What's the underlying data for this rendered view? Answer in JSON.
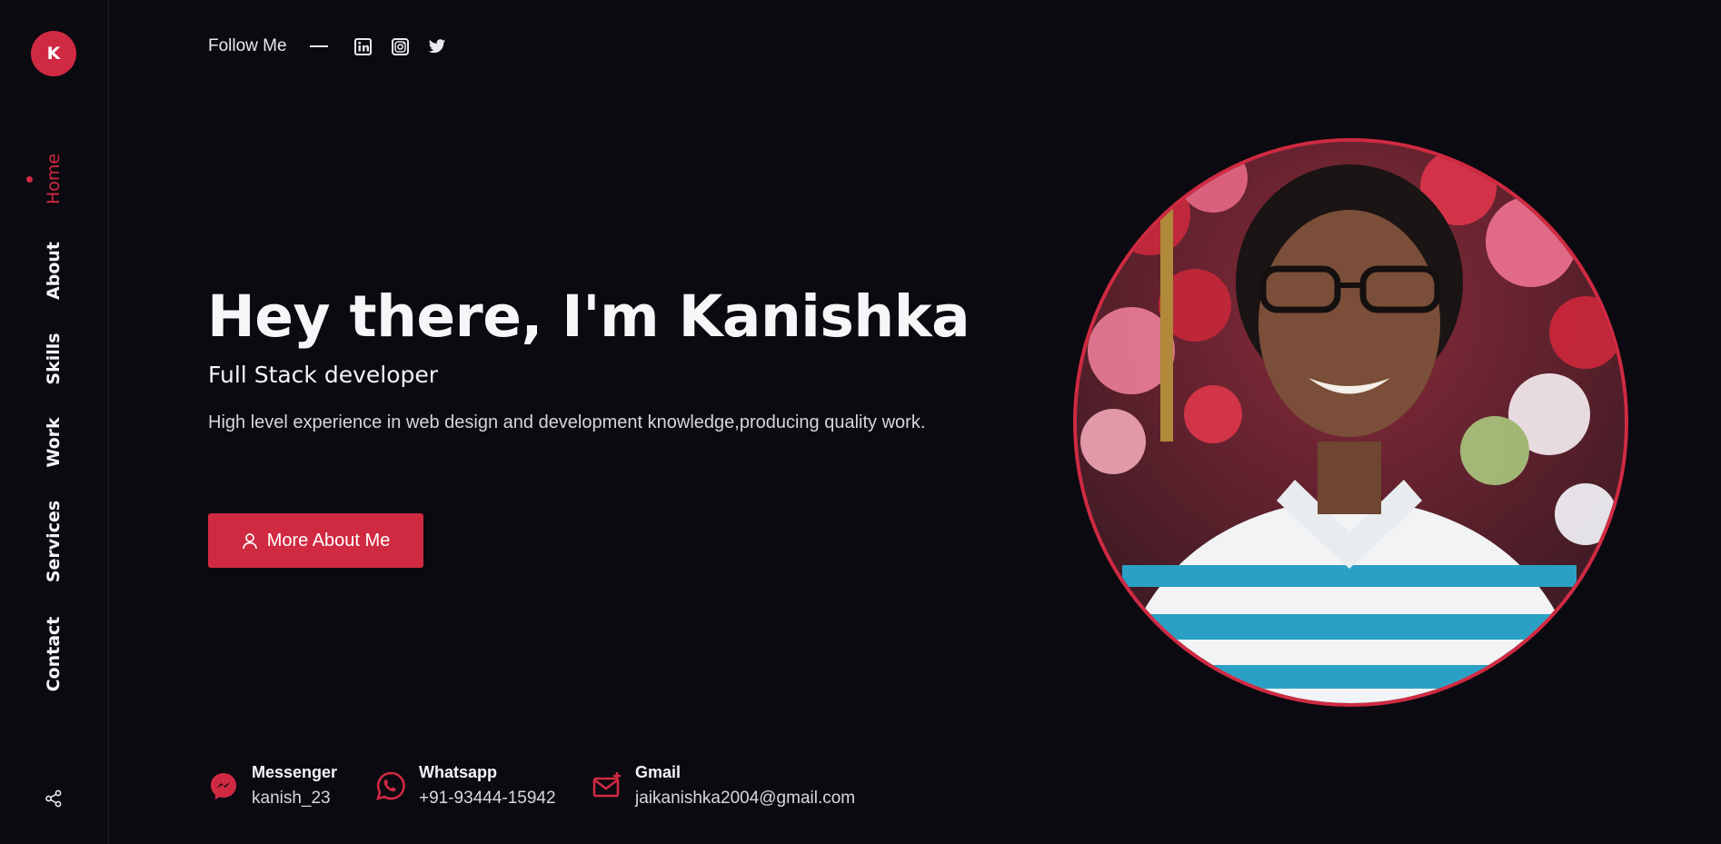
{
  "brand": {
    "logo_letter": "K",
    "accent": "#d02a42",
    "background": "#0b0a10"
  },
  "nav": {
    "items": [
      {
        "label": "Home",
        "active": true
      },
      {
        "label": "About"
      },
      {
        "label": "Skills"
      },
      {
        "label": "Work"
      },
      {
        "label": "Services"
      },
      {
        "label": "Contact"
      }
    ],
    "share_icon": "share-icon"
  },
  "follow": {
    "label": "Follow Me",
    "socials": [
      "linkedin-icon",
      "instagram-icon",
      "twitter-icon"
    ]
  },
  "hero": {
    "title": "Hey there, I'm Kanishka",
    "subtitle": "Full Stack developer",
    "description": "High level experience in web design and development knowledge,producing quality work.",
    "button_label": "More About Me"
  },
  "contacts": [
    {
      "icon": "messenger-icon",
      "title": "Messenger",
      "value": "kanish_23"
    },
    {
      "icon": "whatsapp-icon",
      "title": "Whatsapp",
      "value": "+91-93444-15942"
    },
    {
      "icon": "mail-icon",
      "title": "Gmail",
      "value": "jaikanishka2004@gmail.com"
    }
  ]
}
